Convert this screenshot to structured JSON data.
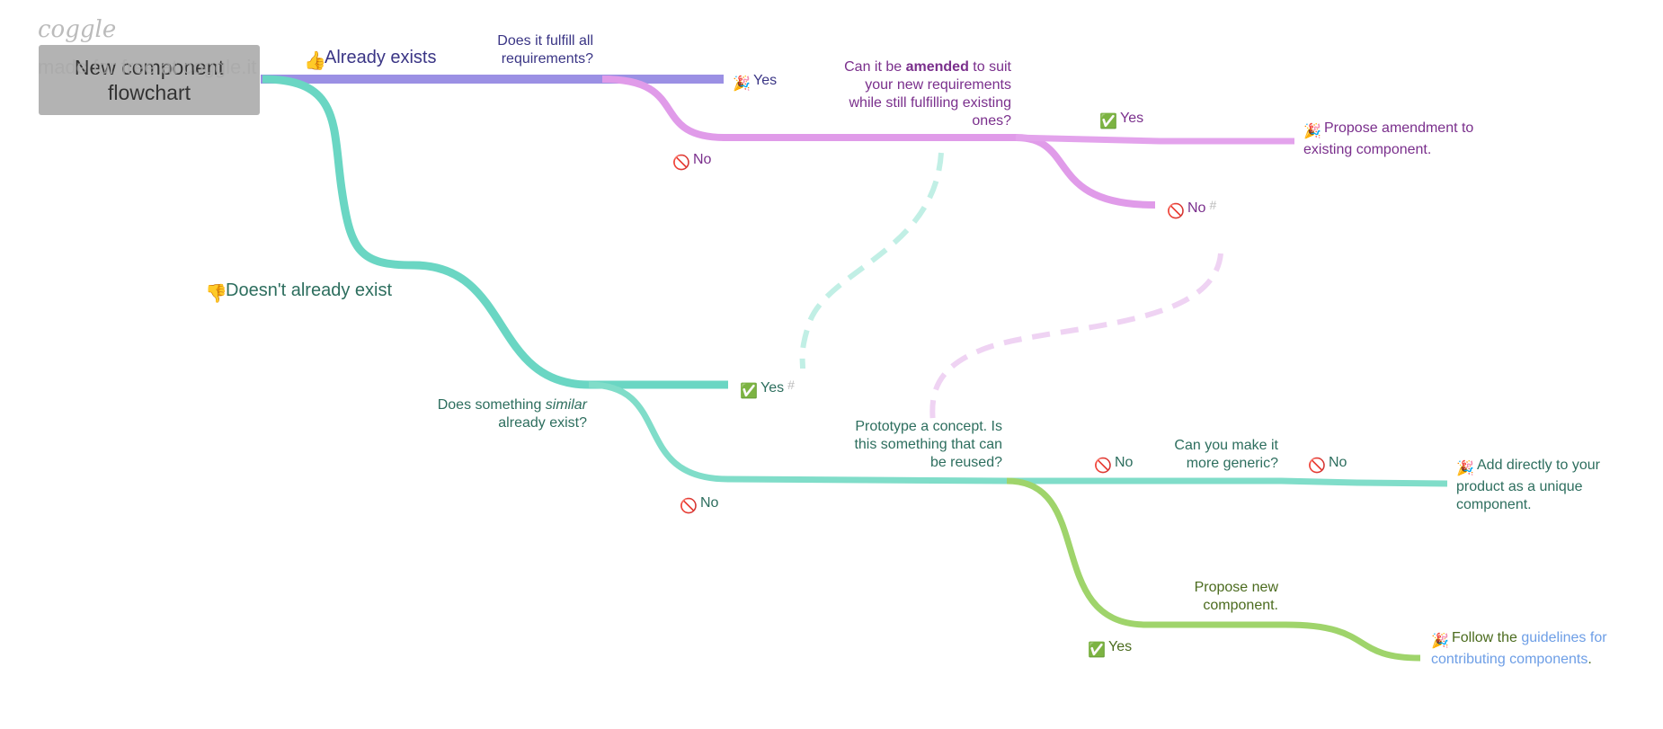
{
  "watermark": {
    "logo": "coggle",
    "text": "made for free at coggle.it"
  },
  "root": {
    "title": "New component flowchart"
  },
  "nodes": {
    "already_exists": "Already exists",
    "fulfill_q": "Does it fulfill all requirements?",
    "yes1": "Yes",
    "no1": "No",
    "amend_q_pre": "Can it be ",
    "amend_q_bold": "amended",
    "amend_q_post": " to suit your new requirements while still fulfilling existing ones?",
    "yes2": "Yes",
    "propose_amend": "Propose amendment to existing component.",
    "no2": "No",
    "doesnt_exist": "Doesn't already exist",
    "similar_q_pre": "Does something ",
    "similar_q_em": "similar",
    "similar_q_post": " already exist?",
    "yes3": "Yes",
    "no3": "No",
    "prototype_q": "Prototype a concept. Is this something that can be reused?",
    "no4": "No",
    "generic_q": "Can you make it more generic?",
    "no5": "No",
    "add_directly": "Add directly to your product as a unique component.",
    "propose_new": "Propose new component.",
    "yes4": "Yes",
    "follow_pre": "Follow the ",
    "follow_link": "guidelines for contributing components",
    "follow_post": ".",
    "hash": "#"
  },
  "colors": {
    "blue_branch": "#9b90e4",
    "pink_branch": "#e09be9",
    "teal_branch": "#6ad6c3",
    "light_teal_branch": "#80ddc9",
    "green_branch": "#9fd46b"
  }
}
